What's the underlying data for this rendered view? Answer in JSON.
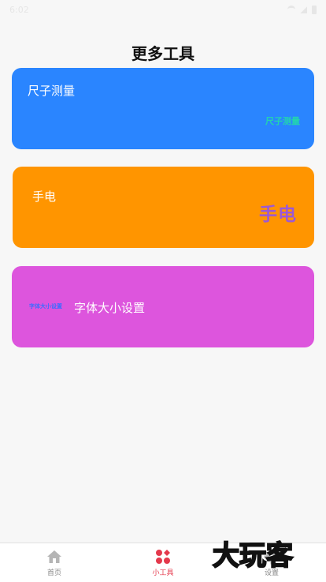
{
  "status_bar": {
    "time": "6:02"
  },
  "header": {
    "title": "更多工具"
  },
  "cards": {
    "ruler": {
      "label": "尺子测量",
      "badge": "尺子测量"
    },
    "flashlight": {
      "label": "手电",
      "badge": "手电"
    },
    "font_size": {
      "label": "字体大小设置",
      "badge": "字体大小设置"
    }
  },
  "bottom_nav": {
    "items": [
      {
        "label": "首页",
        "icon": "home-icon"
      },
      {
        "label": "小工具",
        "icon": "tools-icon"
      },
      {
        "label": "设置",
        "icon": "settings-icon"
      }
    ],
    "active_index": 1
  },
  "watermark": {
    "text": "大玩客"
  },
  "colors": {
    "ruler_card": "#2a85ff",
    "flashlight_card": "#ff9500",
    "font_card": "#dd55dd",
    "active_tab": "#e4394c"
  }
}
